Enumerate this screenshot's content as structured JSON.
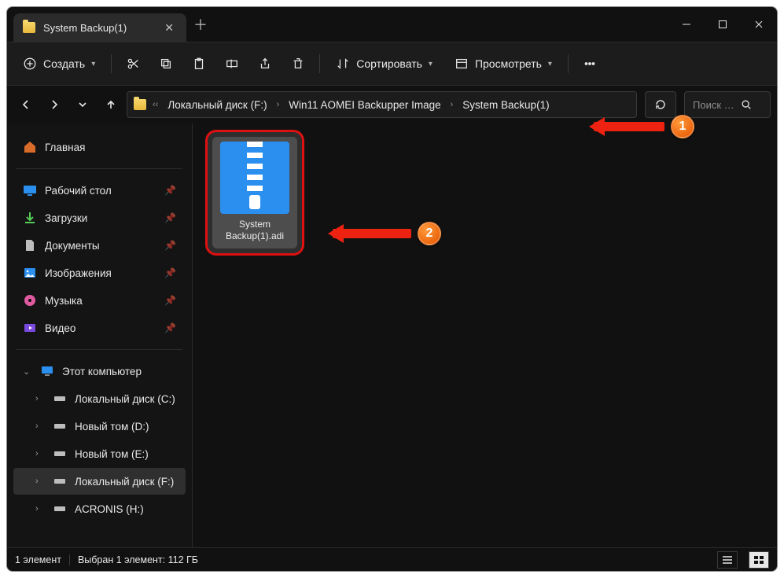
{
  "window": {
    "tab_title": "System Backup(1)"
  },
  "toolbar": {
    "create_label": "Создать",
    "sort_label": "Сортировать",
    "view_label": "Просмотреть"
  },
  "breadcrumbs": {
    "drive": "Локальный диск (F:)",
    "folder1": "Win11 AOMEI Backupper Image",
    "folder2": "System Backup(1)"
  },
  "search": {
    "placeholder": "Поиск …"
  },
  "sidebar": {
    "home": "Главная",
    "desktop": "Рабочий стол",
    "downloads": "Загрузки",
    "documents": "Документы",
    "pictures": "Изображения",
    "music": "Музыка",
    "video": "Видео",
    "this_pc": "Этот компьютер",
    "drive_c": "Локальный диск (C:)",
    "drive_d": "Новый том (D:)",
    "drive_e": "Новый том (E:)",
    "drive_f": "Локальный диск (F:)",
    "drive_h": "ACRONIS (H:)"
  },
  "file": {
    "name_line1": "System",
    "name_line2": "Backup(1).adi"
  },
  "annotations": {
    "badge1": "1",
    "badge2": "2"
  },
  "status": {
    "count": "1 элемент",
    "selected": "Выбран 1 элемент: 112 ГБ"
  }
}
